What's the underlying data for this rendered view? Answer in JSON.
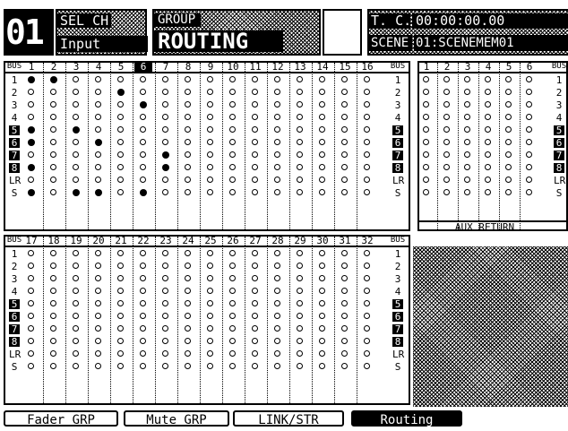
{
  "header": {
    "channel_number": "01",
    "sel_ch_label": "SEL CH",
    "input_label": "Input",
    "group_label": "GROUP",
    "routing_title": "ROUTING",
    "tc_label": "T. C.",
    "timecode": "00:00:00.00",
    "scene_label": "SCENE",
    "scene_value": "01:SCENEMEM01"
  },
  "bus_label": "BUS",
  "matrix1": {
    "columns": [
      "1",
      "2",
      "3",
      "4",
      "5",
      "6",
      "7",
      "8",
      "9",
      "10",
      "11",
      "12",
      "13",
      "14",
      "15",
      "16"
    ],
    "highlight_column": "6",
    "rows": [
      "1",
      "2",
      "3",
      "4",
      "5",
      "6",
      "7",
      "8",
      "LR",
      "S"
    ],
    "highlight_rows": [
      "5",
      "6",
      "7",
      "8"
    ],
    "on": [
      [
        1,
        1,
        0,
        0,
        0,
        0,
        0,
        0,
        0,
        0,
        0,
        0,
        0,
        0,
        0,
        0
      ],
      [
        0,
        0,
        0,
        0,
        1,
        0,
        0,
        0,
        0,
        0,
        0,
        0,
        0,
        0,
        0,
        0
      ],
      [
        0,
        0,
        0,
        0,
        0,
        1,
        0,
        0,
        0,
        0,
        0,
        0,
        0,
        0,
        0,
        0
      ],
      [
        0,
        0,
        0,
        0,
        0,
        0,
        0,
        0,
        0,
        0,
        0,
        0,
        0,
        0,
        0,
        0
      ],
      [
        1,
        0,
        1,
        0,
        0,
        0,
        0,
        0,
        0,
        0,
        0,
        0,
        0,
        0,
        0,
        0
      ],
      [
        1,
        0,
        0,
        1,
        0,
        0,
        0,
        0,
        0,
        0,
        0,
        0,
        0,
        0,
        0,
        0
      ],
      [
        0,
        0,
        0,
        0,
        0,
        0,
        1,
        0,
        0,
        0,
        0,
        0,
        0,
        0,
        0,
        0
      ],
      [
        1,
        0,
        0,
        0,
        0,
        0,
        1,
        0,
        0,
        0,
        0,
        0,
        0,
        0,
        0,
        0
      ],
      [
        0,
        0,
        0,
        0,
        0,
        0,
        0,
        0,
        0,
        0,
        0,
        0,
        0,
        0,
        0,
        0
      ],
      [
        1,
        0,
        1,
        1,
        0,
        1,
        0,
        0,
        0,
        0,
        0,
        0,
        0,
        0,
        0,
        0
      ]
    ]
  },
  "matrix2": {
    "columns": [
      "17",
      "18",
      "19",
      "20",
      "21",
      "22",
      "23",
      "24",
      "25",
      "26",
      "27",
      "28",
      "29",
      "30",
      "31",
      "32"
    ],
    "rows": [
      "1",
      "2",
      "3",
      "4",
      "5",
      "6",
      "7",
      "8",
      "LR",
      "S"
    ],
    "highlight_rows": [
      "5",
      "6",
      "7",
      "8"
    ]
  },
  "aux_return": {
    "columns": [
      "1",
      "2",
      "3",
      "4",
      "5",
      "6"
    ],
    "rows": [
      "1",
      "2",
      "3",
      "4",
      "5",
      "6",
      "7",
      "8",
      "LR",
      "S"
    ],
    "highlight_rows": [
      "5",
      "6",
      "7",
      "8"
    ],
    "label": "AUX RETURN"
  },
  "tabs": [
    {
      "label": "Fader GRP",
      "active": false
    },
    {
      "label": "Mute GRP",
      "active": false
    },
    {
      "label": "LINK/STR",
      "active": false
    },
    {
      "label": "Routing",
      "active": true
    }
  ]
}
